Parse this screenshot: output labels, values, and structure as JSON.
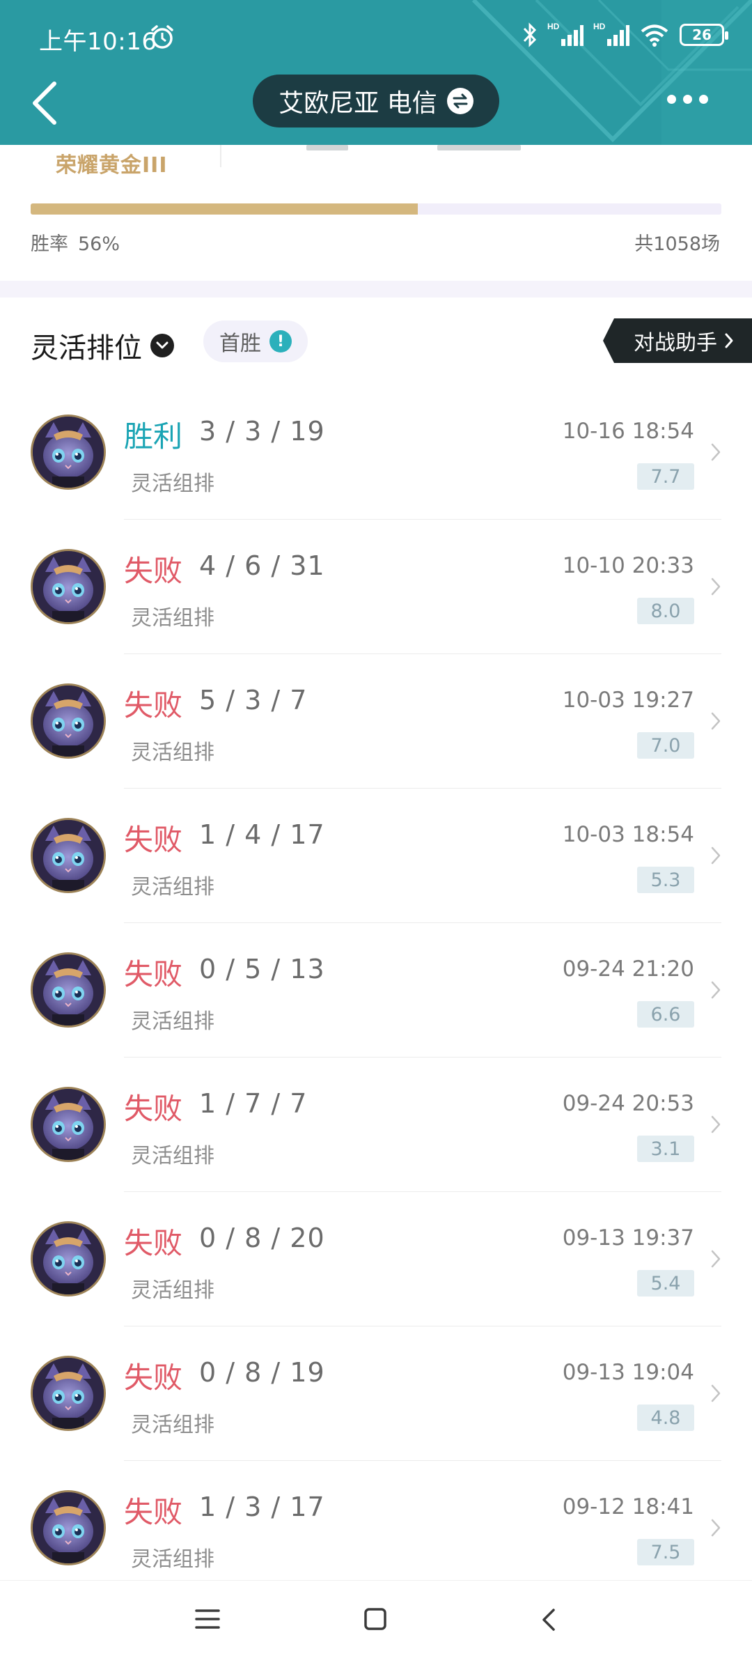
{
  "status_bar": {
    "time": "上午10:16",
    "battery": "26",
    "signal_labels": [
      "HD",
      "HD"
    ]
  },
  "header": {
    "server_name": "艾欧尼亚 电信",
    "back_icon": "back-chevron-icon",
    "more_icon": "more-dots-icon",
    "bg_color": "#2a9aa2"
  },
  "summary": {
    "tier": "荣耀黄金III",
    "win_rate_label": "胜率",
    "win_rate_value": "56%",
    "win_rate_fraction": 0.56,
    "total_games": "共1058场"
  },
  "queue": {
    "title": "灵活排位",
    "first_win_label": "首胜",
    "first_win_badge": "!",
    "assistant_label": "对战助手"
  },
  "colors": {
    "win": "#1aa4b4",
    "loss": "#e05a67",
    "gold": "#c9a46a"
  },
  "matches": [
    {
      "result": "胜利",
      "outcome": "win",
      "kda": "3 / 3 / 19",
      "mode": "灵活组排",
      "time": "10-16 18:54",
      "score": "7.7"
    },
    {
      "result": "失败",
      "outcome": "loss",
      "kda": "4 / 6 / 31",
      "mode": "灵活组排",
      "time": "10-10 20:33",
      "score": "8.0"
    },
    {
      "result": "失败",
      "outcome": "loss",
      "kda": "5 / 3 / 7",
      "mode": "灵活组排",
      "time": "10-03 19:27",
      "score": "7.0"
    },
    {
      "result": "失败",
      "outcome": "loss",
      "kda": "1 / 4 / 17",
      "mode": "灵活组排",
      "time": "10-03 18:54",
      "score": "5.3"
    },
    {
      "result": "失败",
      "outcome": "loss",
      "kda": "0 / 5 / 13",
      "mode": "灵活组排",
      "time": "09-24 21:20",
      "score": "6.6"
    },
    {
      "result": "失败",
      "outcome": "loss",
      "kda": "1 / 7 / 7",
      "mode": "灵活组排",
      "time": "09-24 20:53",
      "score": "3.1"
    },
    {
      "result": "失败",
      "outcome": "loss",
      "kda": "0 / 8 / 20",
      "mode": "灵活组排",
      "time": "09-13 19:37",
      "score": "5.4"
    },
    {
      "result": "失败",
      "outcome": "loss",
      "kda": "0 / 8 / 19",
      "mode": "灵活组排",
      "time": "09-13 19:04",
      "score": "4.8"
    },
    {
      "result": "失败",
      "outcome": "loss",
      "kda": "1 / 3 / 17",
      "mode": "灵活组排",
      "time": "09-12 18:41",
      "score": "7.5"
    }
  ],
  "system_nav": {
    "icons": [
      "menu-icon",
      "home-square-icon",
      "back-triangle-icon"
    ]
  }
}
